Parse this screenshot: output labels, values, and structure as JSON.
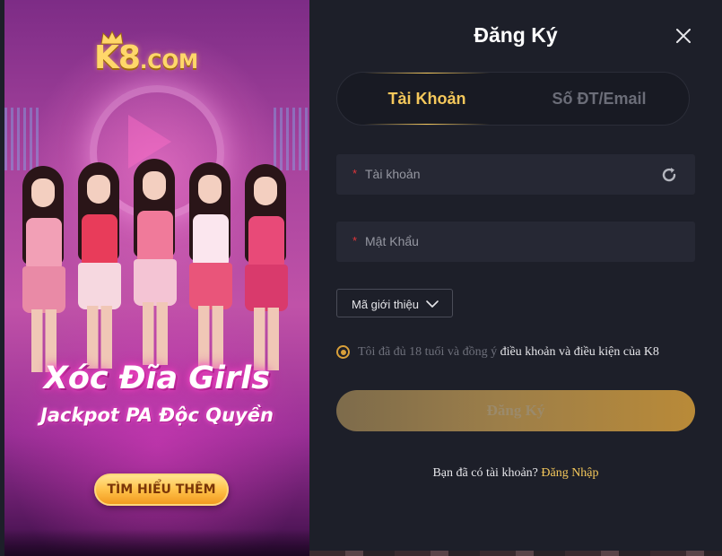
{
  "banner": {
    "logo_text": "K8",
    "logo_suffix": ".COM",
    "headline": "Xóc Đĩa Girls",
    "subheadline": "Jackpot PA Độc Quyền",
    "cta_label": "TÌM HIỂU THÊM"
  },
  "form": {
    "title": "Đăng Ký",
    "tabs": [
      {
        "label": "Tài Khoản",
        "active": true
      },
      {
        "label": "Số ĐT/Email",
        "active": false
      }
    ],
    "fields": {
      "username": {
        "required_mark": "*",
        "placeholder": "Tài khoản",
        "value": ""
      },
      "password": {
        "required_mark": "*",
        "placeholder": "Mật Khẩu",
        "value": ""
      }
    },
    "referral_label": "Mã giới thiệu",
    "agreement": {
      "checked": true,
      "prefix": "Tôi đã đủ 18 tuổi và đồng ý ",
      "link": "điều khoản và điều kiện của K8"
    },
    "submit_label": "Đăng Ký",
    "footer": {
      "question": "Bạn đã có tài khoản? ",
      "login_link": "Đăng Nhập"
    }
  },
  "colors": {
    "accent_gold": "#f5c85b",
    "background": "#1d1f29",
    "field_bg": "#262834",
    "required_red": "#e0353a"
  },
  "icons": [
    "close-icon",
    "refresh-icon",
    "chevron-down-icon",
    "crown-icon"
  ]
}
